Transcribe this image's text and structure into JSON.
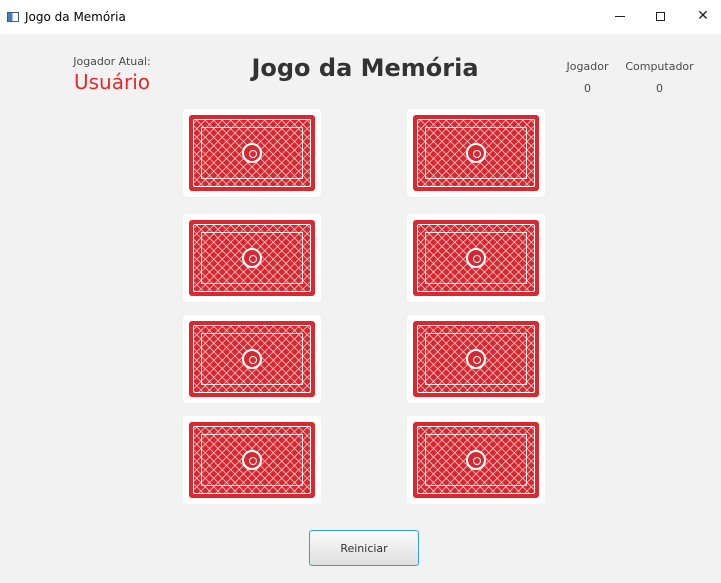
{
  "window": {
    "title": "Jogo da Memória",
    "controls": [
      "minimize",
      "maximize",
      "close"
    ]
  },
  "current_player": {
    "label": "Jogador Atual:",
    "value": "Usuário"
  },
  "game_title": "Jogo da Memória",
  "scoreboard": {
    "player_label": "Jogador",
    "player_score": "0",
    "computer_label": "Computador",
    "computer_score": "0"
  },
  "cards": [
    {
      "state": "face-down"
    },
    {
      "state": "face-down"
    },
    {
      "state": "face-down"
    },
    {
      "state": "face-down"
    },
    {
      "state": "face-down"
    },
    {
      "state": "face-down"
    },
    {
      "state": "face-down"
    },
    {
      "state": "face-down"
    }
  ],
  "restart_button": {
    "label": "Reiniciar"
  },
  "colors": {
    "accent_red": "#e52a2a",
    "card_red": "#d42930",
    "button_border": "#39a0d6"
  }
}
